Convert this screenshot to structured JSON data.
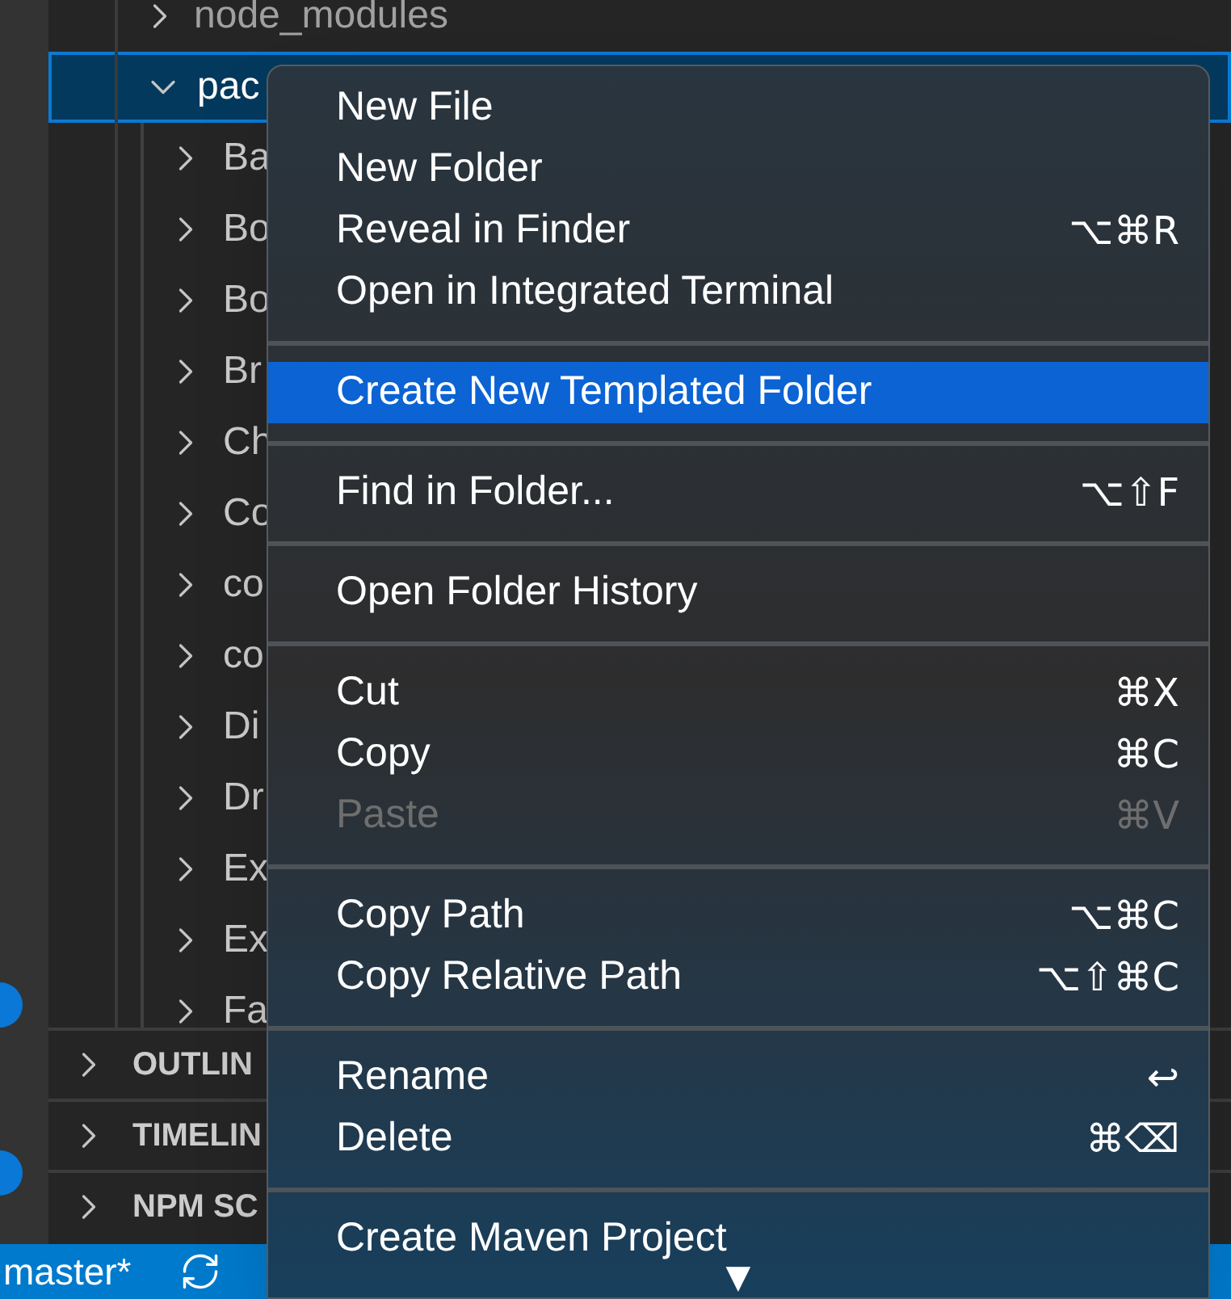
{
  "explorer": {
    "items": [
      {
        "label": "node_modules",
        "expanded": false,
        "selected": false
      },
      {
        "label": "pac",
        "expanded": true,
        "selected": true,
        "children": [
          {
            "label": "Ba"
          },
          {
            "label": "Bo"
          },
          {
            "label": "Bo"
          },
          {
            "label": "Br"
          },
          {
            "label": "Ch"
          },
          {
            "label": "Co"
          },
          {
            "label": "co"
          },
          {
            "label": "co"
          },
          {
            "label": "Di"
          },
          {
            "label": "Dr"
          },
          {
            "label": "Ex"
          },
          {
            "label": "Ex"
          },
          {
            "label": "Fa"
          }
        ]
      }
    ]
  },
  "sections": [
    {
      "label": "OUTLIN",
      "expanded": false
    },
    {
      "label": "TIMELIN",
      "expanded": false
    },
    {
      "label": "NPM SC",
      "expanded": false
    }
  ],
  "status_bar": {
    "branch": "master*"
  },
  "context_menu": {
    "groups": [
      [
        {
          "label": "New File",
          "selected": false,
          "disabled": false
        },
        {
          "label": "New Folder",
          "selected": false,
          "disabled": false
        },
        {
          "label": "Reveal in Finder",
          "shortcut": "⌥⌘R",
          "selected": false,
          "disabled": false
        },
        {
          "label": "Open in Integrated Terminal",
          "selected": false,
          "disabled": false
        }
      ],
      [
        {
          "label": "Create New Templated Folder",
          "selected": true,
          "disabled": false
        }
      ],
      [
        {
          "label": "Find in Folder...",
          "shortcut": "⌥⇧F",
          "selected": false,
          "disabled": false
        }
      ],
      [
        {
          "label": "Open Folder History",
          "selected": false,
          "disabled": false
        }
      ],
      [
        {
          "label": "Cut",
          "shortcut": "⌘X",
          "selected": false,
          "disabled": false
        },
        {
          "label": "Copy",
          "shortcut": "⌘C",
          "selected": false,
          "disabled": false
        },
        {
          "label": "Paste",
          "shortcut": "⌘V",
          "selected": false,
          "disabled": true
        }
      ],
      [
        {
          "label": "Copy Path",
          "shortcut": "⌥⌘C",
          "selected": false,
          "disabled": false
        },
        {
          "label": "Copy Relative Path",
          "shortcut": "⌥⇧⌘C",
          "selected": false,
          "disabled": false
        }
      ],
      [
        {
          "label": "Rename",
          "shortcut": "↩",
          "selected": false,
          "disabled": false
        },
        {
          "label": "Delete",
          "shortcut": "⌘⌫",
          "selected": false,
          "disabled": false
        }
      ],
      [
        {
          "label": "Create Maven Project",
          "selected": false,
          "disabled": false
        }
      ]
    ],
    "scroll_arrow": "▼"
  }
}
